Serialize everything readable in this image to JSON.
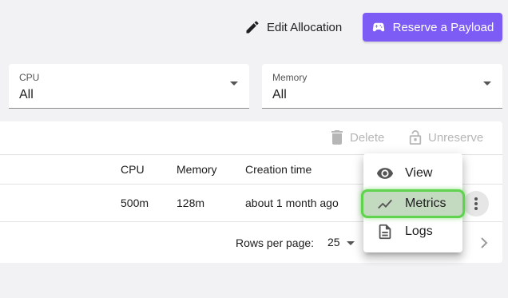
{
  "header": {
    "edit_label": "Edit Allocation",
    "reserve_label": "Reserve a Payload",
    "reserve_color": "#7c5cf5"
  },
  "filters": {
    "cpu": {
      "label": "CPU",
      "value": "All"
    },
    "memory": {
      "label": "Memory",
      "value": "All"
    }
  },
  "toolbar": {
    "delete_label": "Delete",
    "unreserve_label": "Unreserve"
  },
  "table": {
    "columns": [
      "CPU",
      "Memory",
      "Creation time"
    ],
    "rows": [
      {
        "cpu": "500m",
        "memory": "128m",
        "created": "about 1 month ago"
      }
    ]
  },
  "pagination": {
    "rows_per_page_label": "Rows per page:",
    "rows_per_page_value": "25"
  },
  "row_menu": {
    "items": [
      {
        "label": "View",
        "icon": "eye-icon"
      },
      {
        "label": "Metrics",
        "icon": "chart-line-icon",
        "highlighted": true
      },
      {
        "label": "Logs",
        "icon": "document-icon"
      }
    ],
    "highlight_color": "#5fd24e"
  }
}
